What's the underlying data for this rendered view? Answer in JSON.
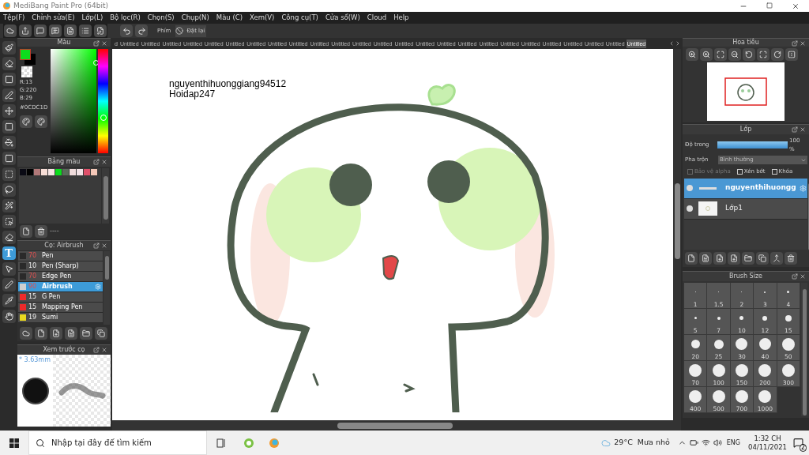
{
  "window": {
    "title": "MediBang Paint Pro (64bit)"
  },
  "menu": [
    "Tệp(F)",
    "Chỉnh sửa(E)",
    "Lớp(L)",
    "Bộ lọc(R)",
    "Chọn(S)",
    "Chụp(N)",
    "Màu (C)",
    "Xem(V)",
    "Công cụ(T)",
    "Cửa sổ(W)",
    "Cloud",
    "Help"
  ],
  "toolbar": {
    "shortcut_label": "Phím",
    "reset_button": "Đặt lại"
  },
  "tools": [
    {
      "kind": "brush",
      "selected": false
    },
    {
      "kind": "eraser",
      "selected": false
    },
    {
      "kind": "rect",
      "selected": false
    },
    {
      "kind": "dotpen",
      "selected": false
    },
    {
      "kind": "move",
      "selected": false
    },
    {
      "kind": "fill",
      "selected": false
    },
    {
      "kind": "bucket",
      "selected": false
    },
    {
      "kind": "gradient",
      "selected": false
    },
    {
      "kind": "select",
      "selected": false
    },
    {
      "kind": "lasso",
      "selected": false
    },
    {
      "kind": "wand",
      "selected": false
    },
    {
      "kind": "selectpen",
      "selected": false
    },
    {
      "kind": "selecteraser",
      "selected": false
    },
    {
      "kind": "text",
      "label": "T",
      "selected": true
    },
    {
      "kind": "operation",
      "selected": false
    },
    {
      "kind": "pen",
      "selected": false
    },
    {
      "kind": "eyedropper",
      "selected": false
    },
    {
      "kind": "hand",
      "selected": false
    }
  ],
  "color_panel": {
    "title": "Màu",
    "r": "R:13",
    "g": "G:220",
    "b": "B:29",
    "hex": "#0CDC1D"
  },
  "palette_panel": {
    "title": "Bảng màu",
    "swatches": [
      {
        "color": "#0a0a14"
      },
      {
        "color": "#000000"
      },
      {
        "color": "#b07878"
      },
      {
        "color": "#f7ddd6"
      },
      {
        "color": "#f5e4e4"
      },
      {
        "color": "#0cdc1d"
      },
      {
        "color": "#5b6b5b"
      },
      {
        "color": "#f0dcdc"
      },
      {
        "color": "#f2e2e6"
      },
      {
        "color": "#e0506a"
      },
      {
        "color": "#f5c8b8"
      }
    ],
    "footer": "----"
  },
  "brush_panel": {
    "title": "Cọ: Airbrush",
    "brushes": [
      {
        "size": "70",
        "name": "Pen",
        "color": "#2a2a2a",
        "size_warning": true,
        "selected": false
      },
      {
        "size": "10",
        "name": "Pen (Sharp)",
        "color": "#2a2a2a",
        "size_warning": false,
        "selected": false
      },
      {
        "size": "70",
        "name": "Edge Pen",
        "color": "#2a2a2a",
        "size_warning": true,
        "selected": false
      },
      {
        "size": "90",
        "name": "Airbrush",
        "color": "#d0d0d0",
        "size_warning": true,
        "selected": true
      },
      {
        "size": "15",
        "name": "G Pen",
        "color": "#ee2a2a",
        "size_warning": false,
        "selected": false
      },
      {
        "size": "15",
        "name": "Mapping Pen",
        "color": "#ee2a2a",
        "size_warning": false,
        "selected": false
      },
      {
        "size": "19",
        "name": "Sumi",
        "color": "#e8d820",
        "size_warning": false,
        "selected": false
      }
    ]
  },
  "preview_panel": {
    "title": "Xem trước cọ",
    "size": "* 3.63mm"
  },
  "tabs": [
    {
      "label": "d",
      "selected": false
    },
    {
      "label": "Untitled",
      "selected": false
    },
    {
      "label": "Untitled",
      "selected": false
    },
    {
      "label": "Untitled",
      "selected": false
    },
    {
      "label": "Untitled",
      "selected": false
    },
    {
      "label": "Untitled",
      "selected": false
    },
    {
      "label": "Untitled",
      "selected": false
    },
    {
      "label": "Untitled",
      "selected": false
    },
    {
      "label": "Untitled",
      "selected": false
    },
    {
      "label": "Untitled",
      "selected": false
    },
    {
      "label": "Untitled",
      "selected": false
    },
    {
      "label": "Untitled",
      "selected": false
    },
    {
      "label": "Untitled",
      "selected": false
    },
    {
      "label": "Untitled",
      "selected": false
    },
    {
      "label": "Untitled",
      "selected": false
    },
    {
      "label": "Untitled",
      "selected": false
    },
    {
      "label": "Untitled",
      "selected": false
    },
    {
      "label": "Untitled",
      "selected": false
    },
    {
      "label": "Untitled",
      "selected": false
    },
    {
      "label": "Untitled",
      "selected": false
    },
    {
      "label": "Untitled",
      "selected": false
    },
    {
      "label": "Untitled",
      "selected": false
    },
    {
      "label": "Untitled",
      "selected": false
    },
    {
      "label": "Untitled",
      "selected": false
    },
    {
      "label": "Untitled",
      "selected": false
    },
    {
      "label": "Untitled",
      "selected": true
    }
  ],
  "canvas": {
    "text_lines": [
      "nguyenthihuonggiang94512",
      "Hoidap247"
    ]
  },
  "navigator": {
    "title": "Hoa tiêu"
  },
  "layer_panel": {
    "title": "Lớp",
    "opacity_label": "Độ trong",
    "opacity": {
      "level": 1.0
    },
    "opacity_value": "100 %",
    "blend_label": "Pha trộn",
    "blend_value": "Bình thường",
    "options": [
      {
        "label": "Bảo vệ alpha",
        "checked": false,
        "disabled": true
      },
      {
        "label": "Xén bớt",
        "checked": false,
        "disabled": false
      },
      {
        "label": "Khóa",
        "checked": false,
        "disabled": false
      }
    ],
    "layers": [
      {
        "name": "nguyenthihuongg",
        "kind": "text",
        "selected": true
      },
      {
        "name": "Lớp1",
        "kind": "drawing",
        "selected": false
      }
    ]
  },
  "brush_size_panel": {
    "title": "Brush Size",
    "sizes": [
      "1",
      "1.5",
      "2",
      "3",
      "4",
      "5",
      "7",
      "10",
      "12",
      "15",
      "20",
      "25",
      "30",
      "40",
      "50",
      "70",
      "100",
      "150",
      "200",
      "300",
      "400",
      "500",
      "700",
      "1000"
    ]
  },
  "taskbar": {
    "search_placeholder": "Nhập tại đây để tìm kiếm",
    "weather": "29°C  Mưa nhỏ",
    "language": "ENG",
    "time": "1:32 CH",
    "date": "04/11/2021",
    "notifications": "2"
  }
}
